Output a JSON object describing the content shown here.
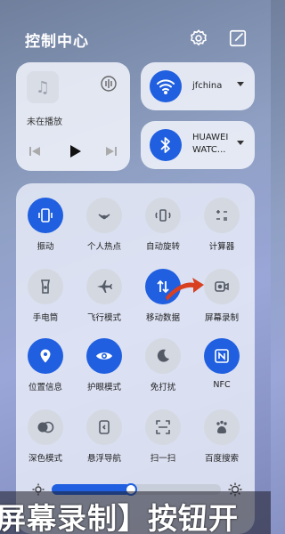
{
  "header": {
    "title": "控制中心"
  },
  "media": {
    "now_playing": "未在播放"
  },
  "wifi": {
    "label": "jfchina"
  },
  "bluetooth": {
    "label_line1": "HUAWEI",
    "label_line2": "WATC..."
  },
  "tiles": [
    {
      "label": "振动",
      "icon": "vibrate-icon",
      "active": true
    },
    {
      "label": "个人热点",
      "icon": "hotspot-icon",
      "active": false
    },
    {
      "label": "自动旋转",
      "icon": "rotate-icon",
      "active": false
    },
    {
      "label": "计算器",
      "icon": "calculator-icon",
      "active": false
    },
    {
      "label": "手电筒",
      "icon": "flashlight-icon",
      "active": false
    },
    {
      "label": "飞行模式",
      "icon": "airplane-icon",
      "active": false
    },
    {
      "label": "移动数据",
      "icon": "mobile-data-icon",
      "active": true
    },
    {
      "label": "屏幕录制",
      "icon": "screen-record-icon",
      "active": false
    },
    {
      "label": "位置信息",
      "icon": "location-icon",
      "active": true
    },
    {
      "label": "护眼模式",
      "icon": "eye-icon",
      "active": true
    },
    {
      "label": "免打扰",
      "icon": "moon-icon",
      "active": false
    },
    {
      "label": "NFC",
      "icon": "nfc-icon",
      "active": true
    },
    {
      "label": "深色模式",
      "icon": "dark-mode-icon",
      "active": false
    },
    {
      "label": "悬浮导航",
      "icon": "float-nav-icon",
      "active": false
    },
    {
      "label": "扫一扫",
      "icon": "scan-icon",
      "active": false
    },
    {
      "label": "百度搜索",
      "icon": "baidu-icon",
      "active": false
    }
  ],
  "brightness": {
    "level": 0.47
  },
  "caption": {
    "text": "屏幕录制】按钮开"
  },
  "colors": {
    "accent": "#1f5fe0",
    "arrow": "#d8401f"
  }
}
